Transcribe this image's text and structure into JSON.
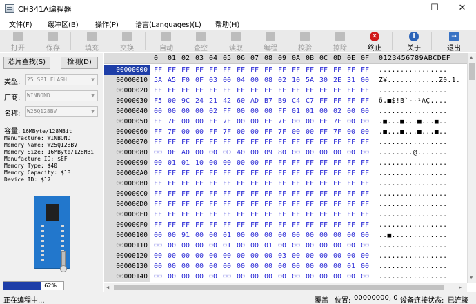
{
  "window": {
    "title": "CH341A编程器",
    "min": "—",
    "max": "☐",
    "close": "✕"
  },
  "menu": [
    "文件(F)",
    "缓冲区(B)",
    "操作(P)",
    "语言(Languages)(L)",
    "帮助(H)"
  ],
  "toolbar": [
    {
      "label": "打开",
      "icon": "folder-open-icon",
      "enabled": false
    },
    {
      "label": "保存",
      "icon": "save-icon",
      "enabled": false
    },
    {
      "label": "填充",
      "icon": "fill-icon",
      "enabled": false
    },
    {
      "label": "交换",
      "icon": "swap-icon",
      "enabled": false
    },
    {
      "label": "自动",
      "icon": "gear-icon",
      "enabled": false
    },
    {
      "label": "查空",
      "icon": "blank-check-icon",
      "enabled": false
    },
    {
      "label": "读取",
      "icon": "read-icon",
      "enabled": false
    },
    {
      "label": "编程",
      "icon": "program-icon",
      "enabled": false
    },
    {
      "label": "校验",
      "icon": "verify-icon",
      "enabled": false
    },
    {
      "label": "擦除",
      "icon": "erase-icon",
      "enabled": false
    },
    {
      "label": "终止",
      "icon": "stop-icon",
      "enabled": true
    },
    {
      "label": "关于",
      "icon": "info-icon",
      "enabled": true
    },
    {
      "label": "退出",
      "icon": "exit-icon",
      "enabled": true
    }
  ],
  "left": {
    "find_chip_btn": "芯片查找(S)",
    "detect_btn": "检测(D)",
    "type_label": "类型:",
    "type_value": "25 SPI FLASH",
    "vendor_label": "厂商:",
    "vendor_value": "WINBOND",
    "name_label": "名称:",
    "name_value": "W25Q128BV",
    "capacity_label": "容量:",
    "capacity_value": "16MByte/128MBit",
    "info": [
      "Manufacture: WINBOND",
      "Memory Name: W25Q128BV",
      "Memory Size: 16MByte/128MBi",
      "Manufacture ID: $EF",
      "Memory Type: $40",
      "Memory Capacity: $18",
      "Device ID: $17"
    ],
    "progress": 0.62,
    "progress_text": "62%"
  },
  "hex": {
    "header_cols": [
      "0",
      "01",
      "02",
      "03",
      "04",
      "05",
      "06",
      "07",
      "08",
      "09",
      "0A",
      "0B",
      "0C",
      "0D",
      "0E",
      "0F"
    ],
    "ascii_header": "0123456789ABCDEF",
    "selected_row": 0,
    "rows": [
      {
        "addr": "00000000",
        "bytes": [
          "FF",
          "FF",
          "FF",
          "FF",
          "FF",
          "FF",
          "FF",
          "FF",
          "FF",
          "FF",
          "FF",
          "FF",
          "FF",
          "FF",
          "FF",
          "FF"
        ],
        "ascii": "................"
      },
      {
        "addr": "00000010",
        "bytes": [
          "5A",
          "A5",
          "F0",
          "0F",
          "03",
          "00",
          "04",
          "00",
          "08",
          "02",
          "10",
          "5A",
          "30",
          "2E",
          "31",
          "00"
        ],
        "ascii": "Z¥............Z0.1."
      },
      {
        "addr": "00000020",
        "bytes": [
          "FF",
          "FF",
          "FF",
          "FF",
          "FF",
          "FF",
          "FF",
          "FF",
          "FF",
          "FF",
          "FF",
          "FF",
          "FF",
          "FF",
          "FF",
          "FF"
        ],
        "ascii": "................"
      },
      {
        "addr": "00000030",
        "bytes": [
          "F5",
          "00",
          "9C",
          "24",
          "21",
          "42",
          "60",
          "AD",
          "B7",
          "B9",
          "C4",
          "C7",
          "FF",
          "FF",
          "FF",
          "FF"
        ],
        "ascii": "õ.■$!B`-·¹ÄÇ...."
      },
      {
        "addr": "00000040",
        "bytes": [
          "00",
          "00",
          "00",
          "00",
          "02",
          "FF",
          "00",
          "00",
          "00",
          "FF",
          "01",
          "01",
          "00",
          "02",
          "00",
          "00"
        ],
        "ascii": "................"
      },
      {
        "addr": "00000050",
        "bytes": [
          "FF",
          "7F",
          "00",
          "00",
          "FF",
          "7F",
          "00",
          "00",
          "FF",
          "7F",
          "00",
          "00",
          "FF",
          "7F",
          "00",
          "00"
        ],
        "ascii": ".■...■...■...■.."
      },
      {
        "addr": "00000060",
        "bytes": [
          "FF",
          "7F",
          "00",
          "00",
          "FF",
          "7F",
          "00",
          "00",
          "FF",
          "7F",
          "00",
          "00",
          "FF",
          "7F",
          "00",
          "00"
        ],
        "ascii": ".■...■...■...■.."
      },
      {
        "addr": "00000070",
        "bytes": [
          "FF",
          "FF",
          "FF",
          "FF",
          "FF",
          "FF",
          "FF",
          "FF",
          "FF",
          "FF",
          "FF",
          "FF",
          "FF",
          "FF",
          "FF",
          "FF"
        ],
        "ascii": "................"
      },
      {
        "addr": "00000080",
        "bytes": [
          "00",
          "0F",
          "A0",
          "00",
          "00",
          "0D",
          "40",
          "00",
          "09",
          "80",
          "00",
          "00",
          "00",
          "00",
          "00",
          "00"
        ],
        "ascii": "........@......."
      },
      {
        "addr": "00000090",
        "bytes": [
          "00",
          "01",
          "01",
          "10",
          "00",
          "00",
          "00",
          "00",
          "FF",
          "FF",
          "FF",
          "FF",
          "FF",
          "FF",
          "FF",
          "FF"
        ],
        "ascii": "................"
      },
      {
        "addr": "000000A0",
        "bytes": [
          "FF",
          "FF",
          "FF",
          "FF",
          "FF",
          "FF",
          "FF",
          "FF",
          "FF",
          "FF",
          "FF",
          "FF",
          "FF",
          "FF",
          "FF",
          "FF"
        ],
        "ascii": "................"
      },
      {
        "addr": "000000B0",
        "bytes": [
          "FF",
          "FF",
          "FF",
          "FF",
          "FF",
          "FF",
          "FF",
          "FF",
          "FF",
          "FF",
          "FF",
          "FF",
          "FF",
          "FF",
          "FF",
          "FF"
        ],
        "ascii": "................"
      },
      {
        "addr": "000000C0",
        "bytes": [
          "FF",
          "FF",
          "FF",
          "FF",
          "FF",
          "FF",
          "FF",
          "FF",
          "FF",
          "FF",
          "FF",
          "FF",
          "FF",
          "FF",
          "FF",
          "FF"
        ],
        "ascii": "................"
      },
      {
        "addr": "000000D0",
        "bytes": [
          "FF",
          "FF",
          "FF",
          "FF",
          "FF",
          "FF",
          "FF",
          "FF",
          "FF",
          "FF",
          "FF",
          "FF",
          "FF",
          "FF",
          "FF",
          "FF"
        ],
        "ascii": "................"
      },
      {
        "addr": "000000E0",
        "bytes": [
          "FF",
          "FF",
          "FF",
          "FF",
          "FF",
          "FF",
          "FF",
          "FF",
          "FF",
          "FF",
          "FF",
          "FF",
          "FF",
          "FF",
          "FF",
          "FF"
        ],
        "ascii": "................"
      },
      {
        "addr": "000000F0",
        "bytes": [
          "FF",
          "FF",
          "FF",
          "FF",
          "FF",
          "FF",
          "FF",
          "FF",
          "FF",
          "FF",
          "FF",
          "FF",
          "FF",
          "FF",
          "FF",
          "FF"
        ],
        "ascii": "................"
      },
      {
        "addr": "00000100",
        "bytes": [
          "00",
          "00",
          "91",
          "00",
          "00",
          "01",
          "00",
          "00",
          "00",
          "00",
          "00",
          "00",
          "00",
          "00",
          "00",
          "00"
        ],
        "ascii": "..■............."
      },
      {
        "addr": "00000110",
        "bytes": [
          "00",
          "00",
          "00",
          "00",
          "00",
          "01",
          "00",
          "00",
          "01",
          "00",
          "00",
          "00",
          "00",
          "00",
          "00",
          "00"
        ],
        "ascii": "................"
      },
      {
        "addr": "00000120",
        "bytes": [
          "00",
          "00",
          "00",
          "00",
          "00",
          "00",
          "00",
          "00",
          "00",
          "03",
          "00",
          "00",
          "00",
          "00",
          "00",
          "00"
        ],
        "ascii": "................"
      },
      {
        "addr": "00000130",
        "bytes": [
          "00",
          "00",
          "00",
          "00",
          "00",
          "00",
          "00",
          "00",
          "00",
          "00",
          "00",
          "00",
          "00",
          "00",
          "01",
          "00"
        ],
        "ascii": "................"
      },
      {
        "addr": "00000140",
        "bytes": [
          "00",
          "00",
          "00",
          "00",
          "00",
          "00",
          "00",
          "00",
          "00",
          "00",
          "00",
          "00",
          "00",
          "00",
          "00",
          "00"
        ],
        "ascii": "................"
      }
    ]
  },
  "status": {
    "message": "正在编程中...",
    "mode": "覆盖",
    "position_label": "位置:",
    "position_value": "00000000, 0",
    "device_label": "设备连接状态:",
    "device_value": "已连接"
  }
}
